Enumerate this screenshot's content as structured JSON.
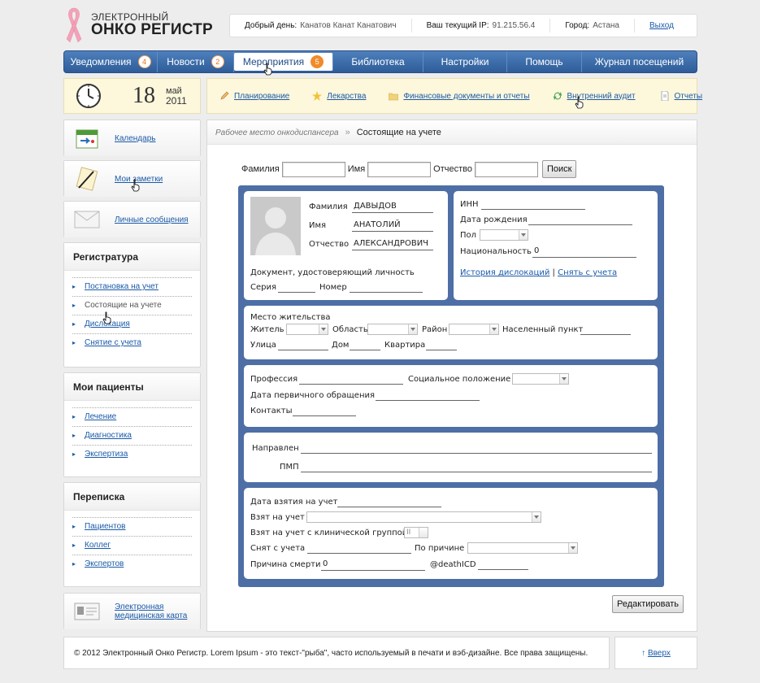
{
  "logo": {
    "small": "ЭЛЕКТРОННЫЙ",
    "big": "ОНКО РЕГИСТР"
  },
  "user": {
    "greeting_label": "Добрый день:",
    "name": "Канатов Канат Канатович",
    "ip_label": "Ваш текущий IP:",
    "ip": "91.215.56.4",
    "city_label": "Город:",
    "city": "Астана",
    "logout": "Выход"
  },
  "nav": [
    {
      "label": "Уведомления",
      "badge": "4"
    },
    {
      "label": "Новости",
      "badge": "2"
    },
    {
      "label": "Мероприятия",
      "badge": "5"
    },
    {
      "label": "Библиотека",
      "badge": ""
    },
    {
      "label": "Настройки",
      "badge": ""
    },
    {
      "label": "Помощь",
      "badge": ""
    },
    {
      "label": "Журнал посещений",
      "badge": ""
    }
  ],
  "date": {
    "day": "18",
    "month": "май",
    "year": "2011"
  },
  "toolbar": [
    {
      "label": "Планирование",
      "icon": "pencil-icon"
    },
    {
      "label": "Лекарства",
      "icon": "star-icon"
    },
    {
      "label": "Финансовые документы и отчеты",
      "icon": "folder-icon"
    },
    {
      "label": "Внутренний аудит",
      "icon": "refresh-icon"
    },
    {
      "label": "Отчеты",
      "icon": "document-icon"
    }
  ],
  "sidebar": {
    "links": [
      {
        "label": "Календарь",
        "icon": "calendar-icon"
      },
      {
        "label": "Мои заметки",
        "icon": "notepad-icon"
      },
      {
        "label": "Личные сообщения",
        "icon": "envelope-icon"
      }
    ],
    "sections": [
      {
        "title": "Регистратура",
        "items": [
          "Постановка на учет",
          "Состоящие на учете",
          "Дислокация",
          "Снятие с учета"
        ]
      },
      {
        "title": "Мои пациенты",
        "items": [
          "Лечение",
          "Диагностика",
          "Экспертиза"
        ]
      },
      {
        "title": "Переписка",
        "items": [
          "Пациентов",
          "Коллег",
          "Экспертов"
        ]
      }
    ],
    "emk": "Электронная медицинская карта"
  },
  "breadcrumb": {
    "parent": "Рабочее место онкодиспансера",
    "sep": "»",
    "current": "Состоящие на учете"
  },
  "search": {
    "surname": "Фамилия",
    "name": "Имя",
    "patronymic": "Отчество",
    "button": "Поиск"
  },
  "patient": {
    "surname_label": "Фамилия",
    "surname": "ДАВЫДОВ",
    "name_label": "Имя",
    "name": "АНАТОЛИЙ",
    "patronymic_label": "Отчество",
    "patronymic": "АЛЕКСАНДРОВИЧ",
    "doc_label": "Документ, удостоверяющий личность",
    "series_label": "Серия",
    "number_label": "Номер",
    "inn_label": "ИНН",
    "birth_label": "Дата рождения",
    "sex_label": "Пол",
    "nationality_label": "Национальность",
    "nationality": "0",
    "history_link": "История дислокаций",
    "sep": "|",
    "remove_link": "Снять с учета",
    "residence_label": "Место жительства",
    "resident_label": "Житель",
    "region_label": "Область",
    "district_label": "Район",
    "locality_label": "Населенный пункт",
    "street_label": "Улица",
    "house_label": "Дом",
    "apt_label": "Квартира",
    "profession_label": "Профессия",
    "social_label": "Социальное положение",
    "first_visit_label": "Дата первичного обращения",
    "contacts_label": "Контакты",
    "referred_label": "Направлен",
    "pmp_label": "ПМП",
    "reg_date_label": "Дата взятия на учет",
    "taken_label": "Взят на учет",
    "clin_group_label": "Взят на учет с клинической группой",
    "clin_group": "II",
    "removed_label": "Снят с учета",
    "reason_label": "По причине",
    "death_label": "Причина смерти",
    "death_value": "0",
    "death_icd": "@deathICD"
  },
  "edit_button": "Редактировать",
  "footer": {
    "text": "© 2012 Электронный Онко Регистр. Lorem Ipsum - это текст-\"рыба\", часто используемый в печати и вэб-дизайне. Все права защищены.",
    "top_link": "Вверх",
    "top_arrow": "↑"
  }
}
